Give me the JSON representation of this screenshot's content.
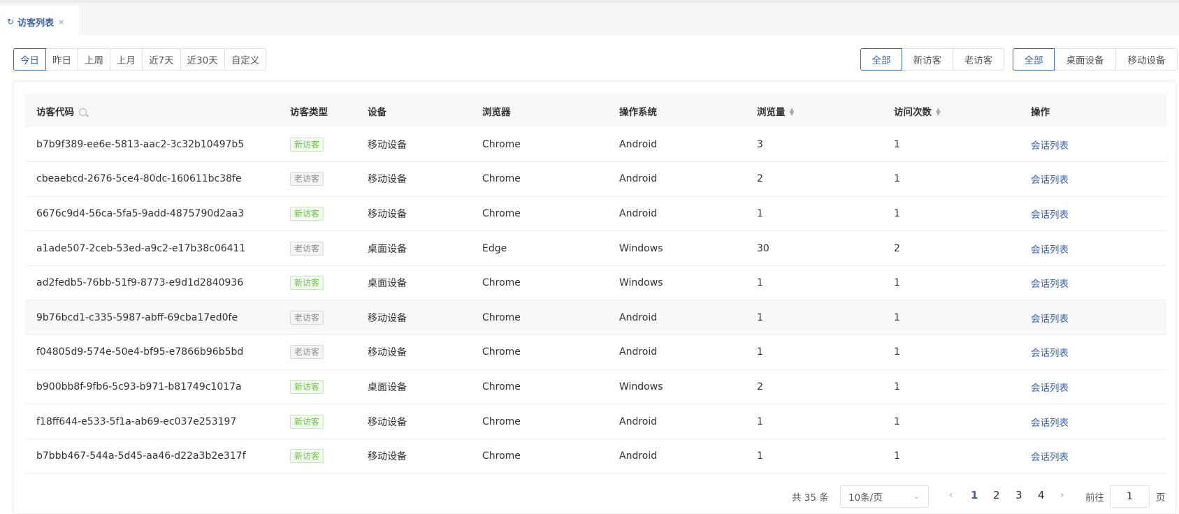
{
  "tab": {
    "title": "访客列表",
    "refresh_icon": "refresh-icon",
    "close_icon": "close-icon",
    "close_glyph": "×",
    "refresh_glyph": "↻"
  },
  "date_filters": [
    "今日",
    "昨日",
    "上周",
    "上月",
    "近7天",
    "近30天",
    "自定义"
  ],
  "visitor_filters": [
    "全部",
    "新访客",
    "老访客"
  ],
  "device_filters": [
    "全部",
    "桌面设备",
    "移动设备"
  ],
  "active": {
    "date": "今日",
    "visitor": "全部",
    "device": "全部"
  },
  "columns": {
    "code": "访客代码",
    "type": "访客类型",
    "device": "设备",
    "browser": "浏览器",
    "os": "操作系统",
    "views": "浏览量",
    "visits": "访问次数",
    "action": "操作"
  },
  "rows": [
    {
      "code": "b7b9f389-ee6e-5813-aac2-3c32b10497b5",
      "type": "新访客",
      "kind": "new",
      "device": "移动设备",
      "browser": "Chrome",
      "os": "Android",
      "views": "3",
      "visits": "1",
      "action": "会话列表"
    },
    {
      "code": "cbeaebcd-2676-5ce4-80dc-160611bc38fe",
      "type": "老访客",
      "kind": "old",
      "device": "移动设备",
      "browser": "Chrome",
      "os": "Android",
      "views": "2",
      "visits": "1",
      "action": "会话列表"
    },
    {
      "code": "6676c9d4-56ca-5fa5-9add-4875790d2aa3",
      "type": "新访客",
      "kind": "new",
      "device": "移动设备",
      "browser": "Chrome",
      "os": "Android",
      "views": "1",
      "visits": "1",
      "action": "会话列表"
    },
    {
      "code": "a1ade507-2ceb-53ed-a9c2-e17b38c06411",
      "type": "老访客",
      "kind": "old",
      "device": "桌面设备",
      "browser": "Edge",
      "os": "Windows",
      "views": "30",
      "visits": "2",
      "action": "会话列表"
    },
    {
      "code": "ad2fedb5-76bb-51f9-8773-e9d1d2840936",
      "type": "新访客",
      "kind": "new",
      "device": "桌面设备",
      "browser": "Chrome",
      "os": "Windows",
      "views": "1",
      "visits": "1",
      "action": "会话列表"
    },
    {
      "code": "9b76bcd1-c335-5987-abff-69cba17ed0fe",
      "type": "老访客",
      "kind": "old",
      "device": "移动设备",
      "browser": "Chrome",
      "os": "Android",
      "views": "1",
      "visits": "1",
      "action": "会话列表"
    },
    {
      "code": "f04805d9-574e-50e4-bf95-e7866b96b5bd",
      "type": "老访客",
      "kind": "old",
      "device": "移动设备",
      "browser": "Chrome",
      "os": "Android",
      "views": "1",
      "visits": "1",
      "action": "会话列表"
    },
    {
      "code": "b900bb8f-9fb6-5c93-b971-b81749c1017a",
      "type": "新访客",
      "kind": "new",
      "device": "桌面设备",
      "browser": "Chrome",
      "os": "Windows",
      "views": "2",
      "visits": "1",
      "action": "会话列表"
    },
    {
      "code": "f18ff644-e533-5f1a-ab69-ec037e253197",
      "type": "新访客",
      "kind": "new",
      "device": "移动设备",
      "browser": "Chrome",
      "os": "Android",
      "views": "1",
      "visits": "1",
      "action": "会话列表"
    },
    {
      "code": "b7bbb467-544a-5d45-aa46-d22a3b2e317f",
      "type": "新访客",
      "kind": "new",
      "device": "移动设备",
      "browser": "Chrome",
      "os": "Android",
      "views": "1",
      "visits": "1",
      "action": "会话列表"
    }
  ],
  "pagination": {
    "total": "共 35 条",
    "page_size": "10条/页",
    "pages": [
      "1",
      "2",
      "3",
      "4"
    ],
    "current": "1",
    "goto_label": "前往",
    "goto_value": "1",
    "page_suffix": "页",
    "prev_glyph": "‹",
    "next_glyph": "›",
    "select_glyph": "⌄"
  },
  "colors": {
    "primary": "#3a63a8",
    "new_tag": "#6fbe4a",
    "old_tag": "#8a8d93"
  }
}
